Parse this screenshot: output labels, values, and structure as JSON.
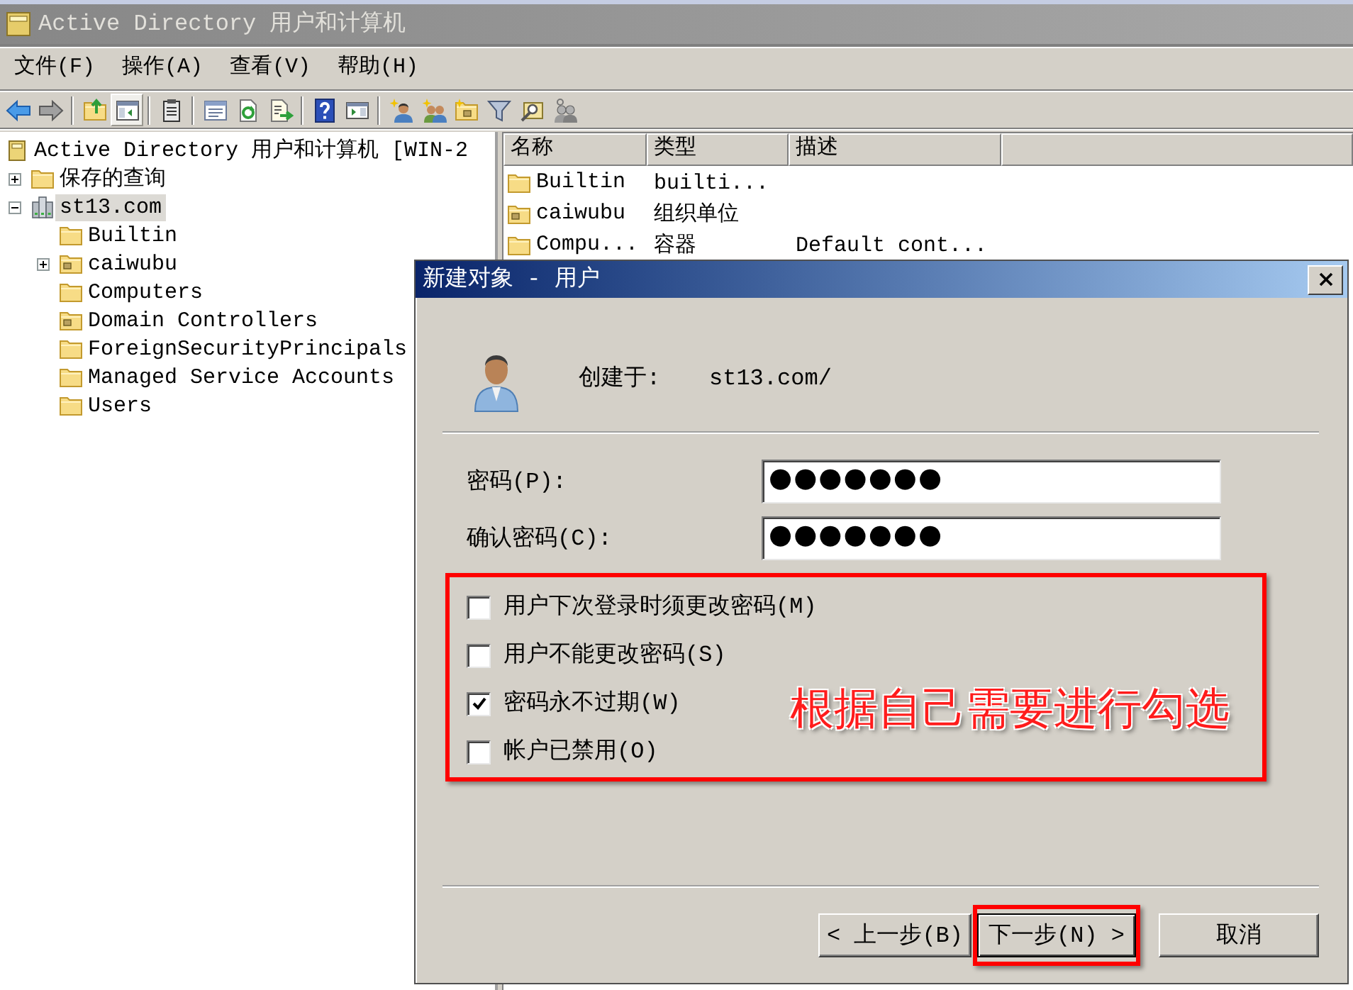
{
  "window": {
    "title": "Active Directory 用户和计算机"
  },
  "menu": [
    "文件(F)",
    "操作(A)",
    "查看(V)",
    "帮助(H)"
  ],
  "toolbar": [
    {
      "kind": "back",
      "pressed": false
    },
    {
      "kind": "forward",
      "pressed": false
    },
    {
      "kind": "separator"
    },
    {
      "kind": "up",
      "pressed": false
    },
    {
      "kind": "tree",
      "pressed": true
    },
    {
      "kind": "separator"
    },
    {
      "kind": "clipboard",
      "pressed": false
    },
    {
      "kind": "separator"
    },
    {
      "kind": "properties",
      "pressed": false
    },
    {
      "kind": "refresh",
      "pressed": false
    },
    {
      "kind": "export",
      "pressed": false
    },
    {
      "kind": "separator"
    },
    {
      "kind": "help",
      "pressed": false
    },
    {
      "kind": "pane",
      "pressed": false
    },
    {
      "kind": "separator"
    },
    {
      "kind": "new_user",
      "pressed": false
    },
    {
      "kind": "new_group",
      "pressed": false
    },
    {
      "kind": "new_ou",
      "pressed": false
    },
    {
      "kind": "filter",
      "pressed": false
    },
    {
      "kind": "find",
      "pressed": false
    },
    {
      "kind": "add_to_group",
      "pressed": false
    }
  ],
  "tree": [
    {
      "label": "Active Directory 用户和计算机 [WIN-2",
      "kind": "snapin",
      "selected": false,
      "children": [
        {
          "label": "保存的查询",
          "kind": "folder",
          "expanded": false,
          "selected": false
        },
        {
          "label": "st13.com",
          "kind": "domain",
          "expanded": true,
          "selected": true,
          "children": [
            {
              "label": "Builtin",
              "kind": "folder",
              "selected": false
            },
            {
              "label": "caiwubu",
              "kind": "ou",
              "expanded": false,
              "selected": false
            },
            {
              "label": "Computers",
              "kind": "folder",
              "selected": false
            },
            {
              "label": "Domain Controllers",
              "kind": "ou",
              "selected": false
            },
            {
              "label": "ForeignSecurityPrincipals",
              "kind": "folder",
              "selected": false
            },
            {
              "label": "Managed Service Accounts",
              "kind": "folder",
              "selected": false
            },
            {
              "label": "Users",
              "kind": "folder",
              "selected": false
            }
          ]
        }
      ]
    }
  ],
  "list": {
    "columns": [
      "名称",
      "类型",
      "描述"
    ],
    "rows": [
      {
        "kind": "folder",
        "name": "Builtin",
        "type": "builti..."
      },
      {
        "kind": "ou",
        "name": "caiwubu",
        "type": "组织单位"
      },
      {
        "kind": "folder",
        "name": "Compu...",
        "type": "容器",
        "description": "Default cont..."
      }
    ]
  },
  "dialog": {
    "title": "新建对象 - 用户",
    "created_in": {
      "label": "创建于:",
      "value": "st13.com/"
    },
    "fields": [
      {
        "label": "密码(P):",
        "value": "●●●●●●●"
      },
      {
        "label": "确认密码(C):",
        "value": "●●●●●●●"
      }
    ],
    "option_group": {
      "highlighted": true,
      "annotation": "根据自己需要进行勾选",
      "options": [
        {
          "label": "用户下次登录时须更改密码(M)",
          "checked": false
        },
        {
          "label": "用户不能更改密码(S)",
          "checked": false
        },
        {
          "label": "密码永不过期(W)",
          "checked": true
        },
        {
          "label": "帐户已禁用(O)",
          "checked": false
        }
      ]
    },
    "buttons": [
      {
        "label": "< 上一步(B)",
        "default": false,
        "highlighted": false
      },
      {
        "label": "下一步(N) >",
        "default": true,
        "highlighted": true
      },
      {
        "label": "取消",
        "default": false,
        "highlighted": false
      }
    ]
  }
}
